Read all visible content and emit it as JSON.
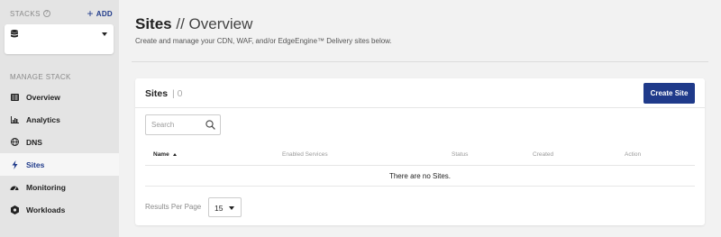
{
  "sidebar": {
    "stacks_label": "STACKS",
    "add_label": "ADD",
    "manage_label": "MANAGE STACK",
    "items": [
      {
        "label": "Overview",
        "icon": "overview-icon"
      },
      {
        "label": "Analytics",
        "icon": "bar-chart-icon"
      },
      {
        "label": "DNS",
        "icon": "globe-icon"
      },
      {
        "label": "Sites",
        "icon": "lightning-bolt-icon",
        "active": true
      },
      {
        "label": "Monitoring",
        "icon": "speedometer-icon"
      },
      {
        "label": "Workloads",
        "icon": "hexagon-gear-icon"
      }
    ]
  },
  "header": {
    "title_bold": "Sites",
    "title_sep": " // Overview",
    "subtitle": "Create and manage your CDN, WAF, and/or EdgeEngine™ Delivery sites below."
  },
  "card": {
    "title": "Sites",
    "count": "| 0",
    "create_label": "Create Site",
    "search_placeholder": "Search",
    "columns": [
      "Name",
      "Enabled Services",
      "Status",
      "Created",
      "Action"
    ],
    "empty_message": "There are no Sites.",
    "results_label": "Results Per Page",
    "results_value": "15"
  },
  "colors": {
    "accent": "#1f3a8a",
    "sidebar_bg": "#e4e4e4",
    "page_bg": "#f2f2f2"
  }
}
